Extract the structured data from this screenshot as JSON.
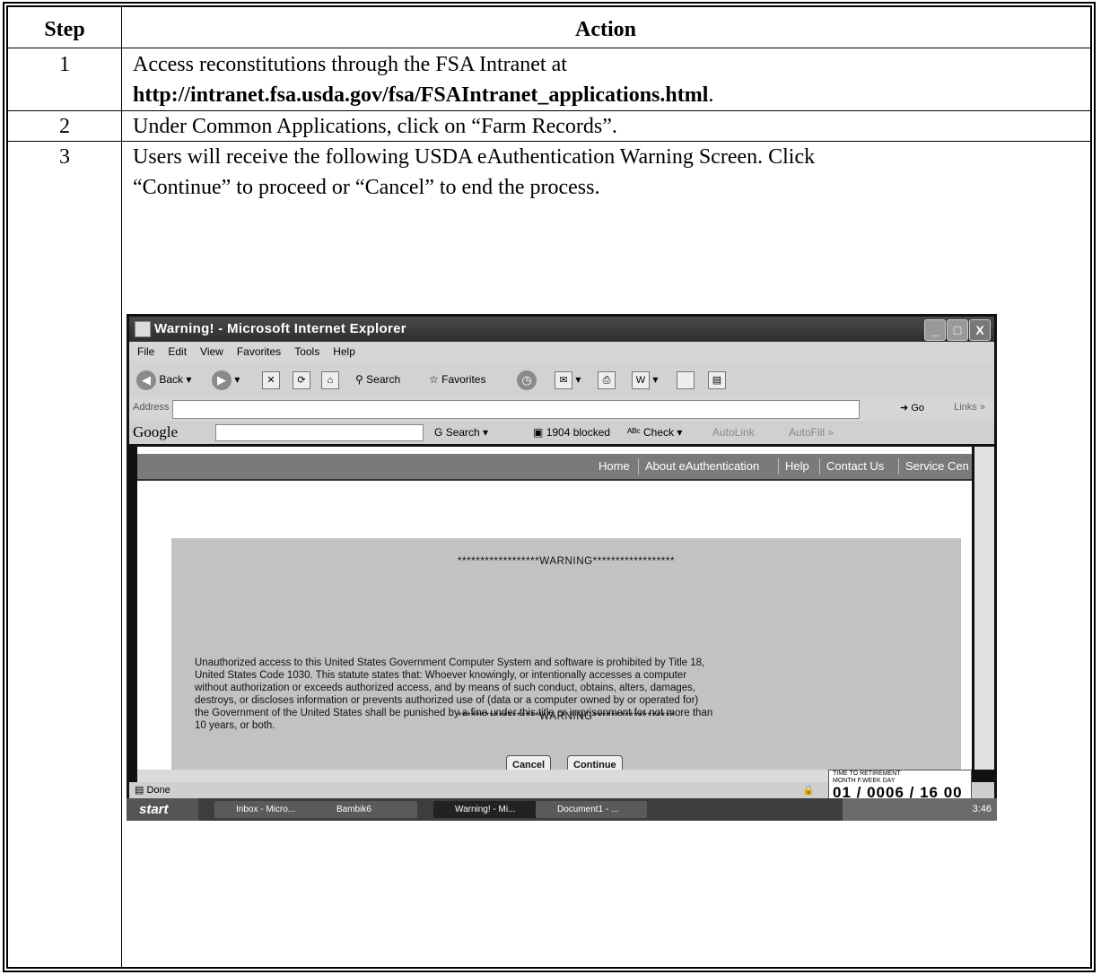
{
  "table": {
    "header_step": "Step",
    "header_action": "Action",
    "rows": [
      {
        "step": "1",
        "text": "Access reconstitutions through the FSA Intranet at",
        "link": "http://intranet.fsa.usda.gov/fsa/FSAIntranet_applications.html",
        "link_suffix": "."
      },
      {
        "step": "2",
        "text": "Under Common Applications, click on “Farm Records”."
      },
      {
        "step": "3",
        "text_line1": "Users will receive the following USDA eAuthentication Warning Screen.  Click",
        "text_line2": "“Continue” to proceed or “Cancel” to end the process."
      }
    ]
  },
  "screenshot": {
    "window_title": "Warning! - Microsoft Internet Explorer",
    "window_buttons": [
      "_",
      "□",
      "X"
    ],
    "menu": [
      "File",
      "Edit",
      "View",
      "Favorites",
      "Tools",
      "Help"
    ],
    "toolbar": {
      "back": "Back",
      "search": "Search",
      "favorites": "Favorites"
    },
    "address_label": "Address",
    "go_label": "Go",
    "links_label": "Links",
    "google": {
      "brand": "Google",
      "search": "Search",
      "blocked": "1904 blocked",
      "check": "Check",
      "autolink": "AutoLink",
      "autofill": "AutoFill"
    },
    "nav": [
      "Home",
      "About eAuthentication",
      "Help",
      "Contact Us",
      "Service Cen"
    ],
    "warning_header": "******************WARNING******************",
    "warning_lines": [
      "Unauthorized access to this United States Government Computer System and software is prohibited by Title 18,",
      "United States Code 1030. This statute states that: Whoever knowingly, or intentionally accesses a computer",
      "without authorization or exceeds authorized access, and by means of such conduct, obtains, alters, damages,",
      "destroys, or discloses information or prevents authorized use of (data or a computer owned by or operated for)",
      "the Government of the United States shall be punished by a fine under this title or imprisonment for not more than",
      "10 years, or both."
    ],
    "warning_footer": "******************WARNING******************",
    "cancel_button": "Cancel",
    "continue_button": "Continue",
    "status_text": "Done",
    "retirement": {
      "heading": "TIME TO RETIREMENT",
      "sub": "MONTH  F.WEEK   DAY",
      "value": "01 / 0006 / 16 00"
    },
    "taskbar": {
      "start": "start",
      "tasks": [
        "Inbox - Micro...",
        "Bambik6",
        "Warning! - Mi...",
        "Document1 - ..."
      ],
      "clock": "3:46"
    }
  }
}
